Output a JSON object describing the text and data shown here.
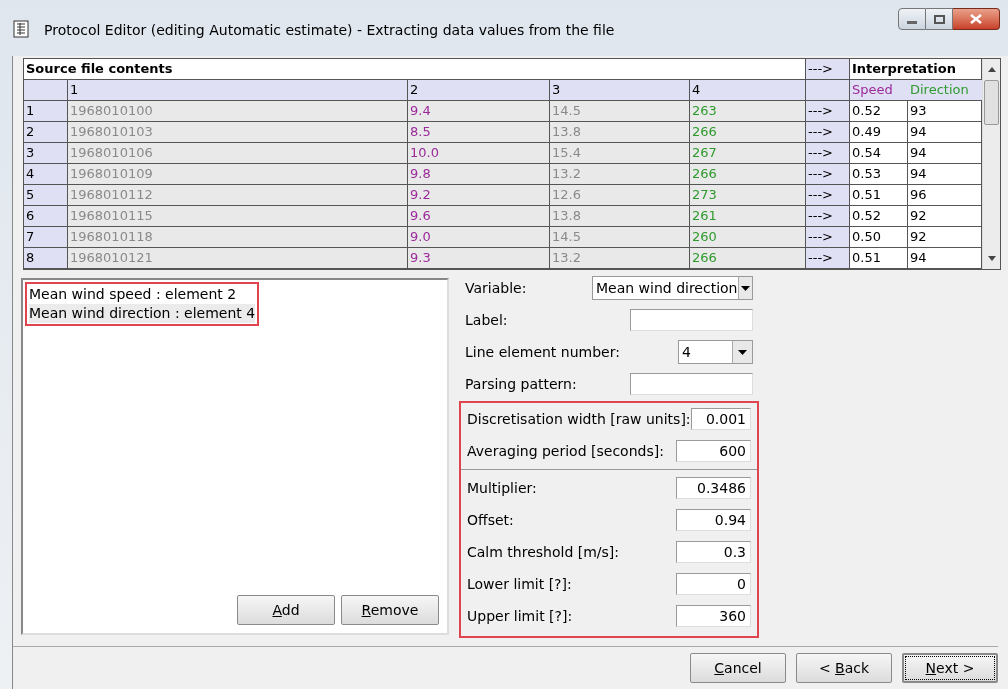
{
  "window": {
    "title": "Protocol Editor (editing Automatic estimate) - Extracting data values from the file"
  },
  "source_table": {
    "title": "Source file contents",
    "arrow_header": "--->",
    "interpretation_title": "Interpretation",
    "columns": [
      {
        "label": "1",
        "color": "#8a8a8a"
      },
      {
        "label": "2",
        "color": "#9b2a9b"
      },
      {
        "label": "3",
        "color": "#8a8a8a"
      },
      {
        "label": "4",
        "color": "#2e9a2e"
      }
    ],
    "interpretation_columns": [
      {
        "label": "Speed",
        "color": "#9b2a9b"
      },
      {
        "label": "Direction",
        "color": "#2e9a2e"
      }
    ],
    "rows": [
      {
        "index": "1",
        "cells": [
          "1968010100",
          "9.4",
          "14.5",
          "263"
        ],
        "arrow": "--->",
        "interpretation": [
          "0.52",
          "93"
        ]
      },
      {
        "index": "2",
        "cells": [
          "1968010103",
          "8.5",
          "13.8",
          "266"
        ],
        "arrow": "--->",
        "interpretation": [
          "0.49",
          "94"
        ]
      },
      {
        "index": "3",
        "cells": [
          "1968010106",
          "10.0",
          "15.4",
          "267"
        ],
        "arrow": "--->",
        "interpretation": [
          "0.54",
          "94"
        ]
      },
      {
        "index": "4",
        "cells": [
          "1968010109",
          "9.8",
          "13.2",
          "266"
        ],
        "arrow": "--->",
        "interpretation": [
          "0.53",
          "94"
        ]
      },
      {
        "index": "5",
        "cells": [
          "1968010112",
          "9.2",
          "12.6",
          "273"
        ],
        "arrow": "--->",
        "interpretation": [
          "0.51",
          "96"
        ]
      },
      {
        "index": "6",
        "cells": [
          "1968010115",
          "9.6",
          "13.8",
          "261"
        ],
        "arrow": "--->",
        "interpretation": [
          "0.52",
          "92"
        ]
      },
      {
        "index": "7",
        "cells": [
          "1968010118",
          "9.0",
          "14.5",
          "260"
        ],
        "arrow": "--->",
        "interpretation": [
          "0.50",
          "92"
        ]
      },
      {
        "index": "8",
        "cells": [
          "1968010121",
          "9.3",
          "13.2",
          "266"
        ],
        "arrow": "--->",
        "interpretation": [
          "0.51",
          "94"
        ]
      }
    ]
  },
  "variables_list": {
    "items": [
      {
        "label": "Mean wind speed : element 2",
        "selected": false
      },
      {
        "label": "Mean wind direction : element 4",
        "selected": true
      }
    ],
    "buttons": [
      {
        "key": "A",
        "after": "dd"
      },
      {
        "key": "R",
        "after": "emove"
      }
    ]
  },
  "form": {
    "fields": [
      {
        "kind": "dropdown",
        "label": "Variable:",
        "value": "Mean wind direction"
      },
      {
        "kind": "text",
        "label": "Label:"
      },
      {
        "kind": "dropdown",
        "label": "Line element number:",
        "value": "4"
      },
      {
        "kind": "text",
        "label": "Parsing pattern:"
      }
    ],
    "discretisation_fields": [
      {
        "label": "Discretisation width [raw units]:",
        "value": "0.001"
      },
      {
        "label": "Averaging period [seconds]:",
        "value": "600"
      }
    ],
    "transform_fields": [
      {
        "label": "Multiplier:",
        "value": "0.3486"
      },
      {
        "label": "Offset:",
        "value": "0.94"
      },
      {
        "label": "Calm threshold [m/s]:",
        "value": "0.3"
      },
      {
        "label": "Lower limit [?]:",
        "value": "0"
      },
      {
        "label": "Upper limit [?]:",
        "value": "360"
      }
    ]
  },
  "footer_buttons": [
    {
      "key": "C",
      "after": "ancel",
      "default": false
    },
    {
      "before": "< ",
      "key": "B",
      "after": "ack",
      "default": false
    },
    {
      "key": "N",
      "after": "ext >",
      "default": true
    }
  ]
}
